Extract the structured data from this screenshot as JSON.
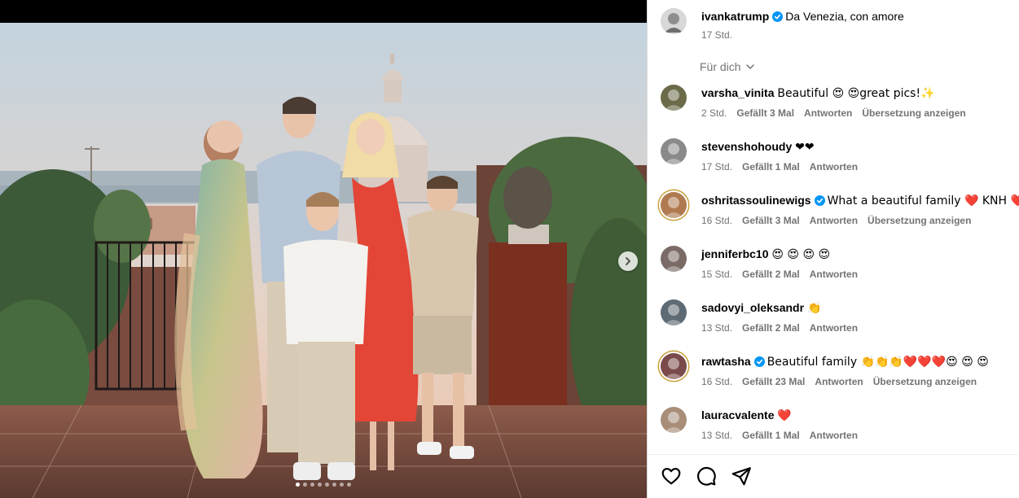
{
  "post": {
    "author": "ivankatrump",
    "caption": "Da Venezia, con amore",
    "time": "17 Std.",
    "sort_label": "Für dich",
    "carousel": {
      "slides": 8,
      "active": 0
    }
  },
  "comments": [
    {
      "user": "varsha_vinita",
      "verified": false,
      "text": "Beautiful 😍 😍great pics!✨",
      "time": "2 Std.",
      "likes": "Gefällt 3 Mal",
      "reply": "Antworten",
      "translate": "Übersetzung anzeigen",
      "ring": false
    },
    {
      "user": "stevenshohoudy",
      "verified": false,
      "text": "❤❤",
      "time": "17 Std.",
      "likes": "Gefällt 1 Mal",
      "reply": "Antworten",
      "translate": "",
      "ring": false
    },
    {
      "user": "oshritassoulinewigs",
      "verified": true,
      "text": "What a beautiful family ❤️ KNH ❤️",
      "time": "16 Std.",
      "likes": "Gefällt 3 Mal",
      "reply": "Antworten",
      "translate": "Übersetzung anzeigen",
      "ring": true
    },
    {
      "user": "jenniferbc10",
      "verified": false,
      "text": "😍 😍 😍 😍",
      "time": "15 Std.",
      "likes": "Gefällt 2 Mal",
      "reply": "Antworten",
      "translate": "",
      "ring": false
    },
    {
      "user": "sadovyi_oleksandr",
      "verified": false,
      "text": "👏",
      "time": "13 Std.",
      "likes": "Gefällt 2 Mal",
      "reply": "Antworten",
      "translate": "",
      "ring": false
    },
    {
      "user": "rawtasha",
      "verified": true,
      "text": "Beautiful family 👏👏👏❤️❤️❤️😍 😍 😍",
      "time": "16 Std.",
      "likes": "Gefällt 23 Mal",
      "reply": "Antworten",
      "translate": "Übersetzung anzeigen",
      "ring": true
    },
    {
      "user": "lauracvalente",
      "verified": false,
      "text": "❤️",
      "time": "13 Std.",
      "likes": "Gefällt 1 Mal",
      "reply": "Antworten",
      "translate": "",
      "ring": false
    }
  ],
  "icons": {
    "verified": "verified-badge-icon",
    "next": "chevron-right-icon",
    "sort": "chevron-down-icon",
    "like": "heart-outline-icon",
    "comment": "speech-bubble-icon",
    "share": "paper-plane-icon"
  },
  "colors": {
    "verified": "#0095f6",
    "meta": "#737373",
    "story_ring": "#c9a03a"
  }
}
